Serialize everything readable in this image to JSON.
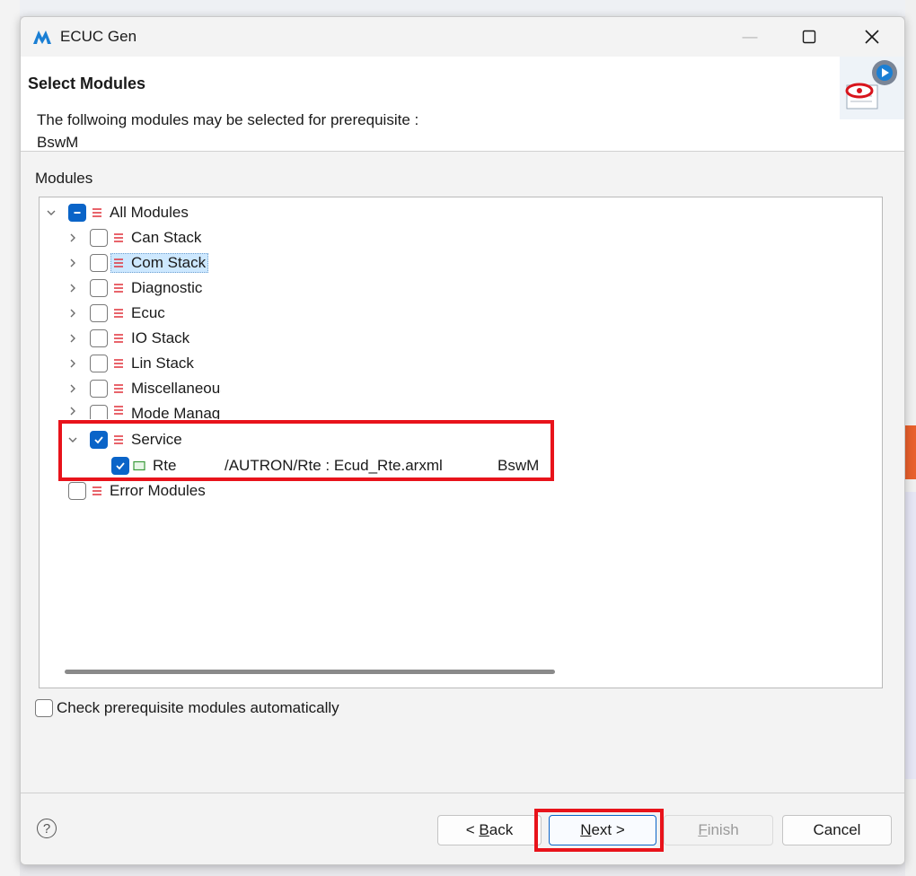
{
  "window": {
    "title": "ECUC Gen",
    "minimize_glyph": "—",
    "maximize_glyph": "☐",
    "close_glyph": "✕"
  },
  "header": {
    "title": "Select Modules",
    "description_line1": "The follwoing modules may be selected for prerequisite :",
    "description_line2": "BswM"
  },
  "modules_label": "Modules",
  "tree": {
    "root": {
      "label": "All Modules",
      "state": "partial"
    },
    "children": [
      {
        "label": "Can Stack",
        "checked": false
      },
      {
        "label": "Com Stack",
        "checked": false,
        "selected": true
      },
      {
        "label": "Diagnostic",
        "checked": false
      },
      {
        "label": "Ecuc",
        "checked": false
      },
      {
        "label": "IO Stack",
        "checked": false
      },
      {
        "label": "Lin Stack",
        "checked": false
      },
      {
        "label": "Miscellaneous",
        "checked": false
      },
      {
        "label": "Mode Management",
        "checked": false
      },
      {
        "label": "Service",
        "checked": true,
        "expanded": true
      }
    ],
    "service_child": {
      "label": "Rte",
      "path": "/AUTRON/Rte : Ecud_Rte.arxml",
      "required_by": "BswM",
      "checked": true
    },
    "error_modules": {
      "label": "Error Modules",
      "checked": false
    }
  },
  "auto_check_label": "Check prerequisite modules automatically",
  "buttons": {
    "back": {
      "prefix": "< ",
      "mnemonic": "B",
      "rest": "ack"
    },
    "next": {
      "mnemonic": "N",
      "rest": "ext >"
    },
    "finish": {
      "mnemonic": "F",
      "rest": "inish"
    },
    "cancel": "Cancel"
  },
  "help_glyph": "?",
  "colors": {
    "accent": "#0a64c8",
    "highlight": "#e8131b",
    "module_icon": "#e0303a",
    "file_icon": "#3a9a3a"
  },
  "icons": {
    "app": "ecuc-logo-icon",
    "wizard": "wizard-banner-icon",
    "module": "module-list-icon",
    "file": "arxml-file-icon"
  }
}
